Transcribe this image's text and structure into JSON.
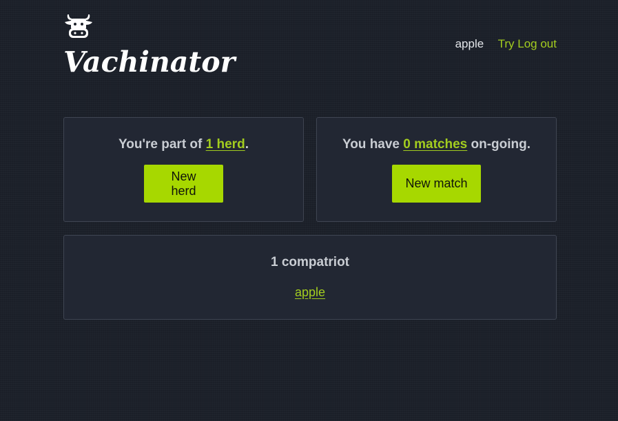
{
  "header": {
    "brand": "Vachinator",
    "logo_icon": "cow-face-icon",
    "nav": {
      "username": "apple",
      "try_link": "Try",
      "logout_link": "Log out"
    }
  },
  "herds": {
    "prefix": "You're part of ",
    "link": "1 herd",
    "suffix": ".",
    "button": "New herd"
  },
  "matches": {
    "prefix": "You have ",
    "link": "0 matches",
    "suffix": " on-going.",
    "button": "New match"
  },
  "compatriots": {
    "title": "1 compatriot",
    "members": [
      "apple"
    ]
  },
  "colors": {
    "background": "#1c212a",
    "card": "#222733",
    "accent": "#a7d800",
    "link": "#a3cd1f"
  }
}
